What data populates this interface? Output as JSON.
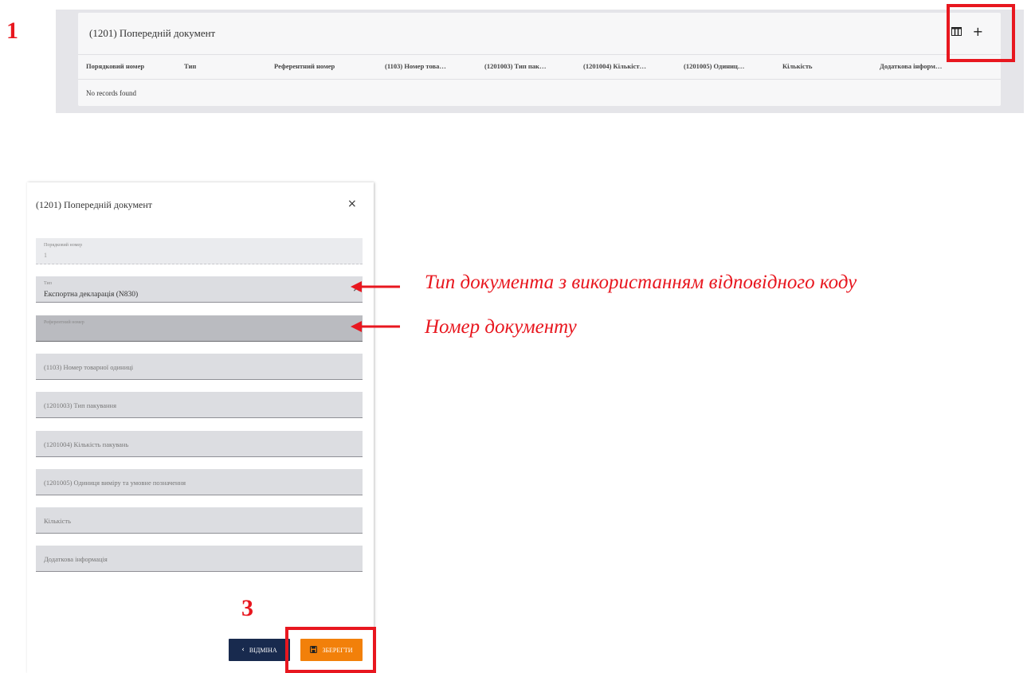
{
  "steps": {
    "step1": "1",
    "step3": "3"
  },
  "table": {
    "title": "(1201) Попередній документ",
    "columns": [
      "Порядковий номер",
      "Тип",
      "Референтний номер",
      "(1103) Номер това…",
      "(1201003) Тип пак…",
      "(1201004) Кількіст…",
      "(1201005) Одиниц…",
      "Кількість",
      "Додаткова інформ…"
    ],
    "empty_text": "No records found",
    "icons": [
      "columns-icon",
      "plus-icon"
    ],
    "add_glyph": "+"
  },
  "dialog": {
    "title": "(1201) Попередній документ",
    "close_glyph": "×",
    "fields": {
      "seq": {
        "label": "Порядковий номер",
        "value": "1"
      },
      "type": {
        "label": "Тип",
        "value": "Експортна декларація (N830)",
        "clear_glyph": "×"
      },
      "ref": {
        "label": "Референтний номер",
        "value": ""
      },
      "item": {
        "placeholder": "(1103) Номер товарної одиниці"
      },
      "pack_type": {
        "placeholder": "(1201003) Тип пакування"
      },
      "pack_count": {
        "placeholder": "(1201004) Кількість пакувань"
      },
      "unit": {
        "placeholder": "(1201005) Одиниця виміру та умовне позначення"
      },
      "qty": {
        "placeholder": "Кількість"
      },
      "extra": {
        "placeholder": "Додаткова інформація"
      }
    },
    "buttons": {
      "cancel": {
        "label": "ВІДМІНА",
        "icon": "chevron-left-icon",
        "glyph": "‹"
      },
      "save": {
        "label": "ЗБЕРЕГТИ",
        "icon": "floppy-disk-icon"
      }
    }
  },
  "annotations": {
    "type_note": "Тип документа з використанням відповідного коду",
    "ref_note": "Номер документу"
  },
  "colors": {
    "highlight": "#e8171f",
    "cancel_btn": "#182a4e",
    "save_btn": "#f2800a",
    "field_bg": "#dcdde1"
  }
}
